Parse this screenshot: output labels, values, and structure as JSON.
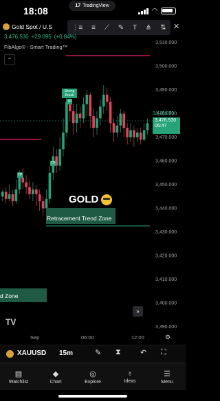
{
  "status": {
    "time": "18:08",
    "app_pill": "TradingView"
  },
  "header": {
    "symbol_title": "Gold Spot / U.S",
    "price": "3,476.530",
    "change": "+29.095",
    "change_pct": "(+0.84%)",
    "indicator": "FibAlgo® - Smart Trading™",
    "collapse_icon": "chevron-up-icon"
  },
  "chart": {
    "price_tag_top": "3,478.070",
    "price_tag_value": "3,476.530",
    "price_tag_countdown": "06:47",
    "signals": [
      "Strong Break",
      "TP",
      "TP",
      "TP"
    ],
    "zone_label": "Retracement Trend Zone",
    "zone_label_lower": "d Zone",
    "caption": "GOLD",
    "y_axis": [
      "3,510.000",
      "3,500.000",
      "3,490.000",
      "3,480.000",
      "3,470.000",
      "3,460.000",
      "3,450.000",
      "3,440.000",
      "3,430.000",
      "3,420.000",
      "3,410.000",
      "3,400.000",
      "3,390.000"
    ],
    "x_axis": [
      "Sep",
      "06:00",
      "12:00"
    ],
    "logo": "TV",
    "colors": {
      "up": "#27a37a",
      "down": "#e0445a",
      "zone": "#1f5a45",
      "resistance": "#c2185b"
    }
  },
  "symbol_bar": {
    "symbol": "XAUUSD",
    "interval": "15m"
  },
  "tabs": [
    {
      "label": "Watchlist",
      "icon": "watchlist-icon"
    },
    {
      "label": "Chart",
      "icon": "chart-icon"
    },
    {
      "label": "Explore",
      "icon": "explore-icon"
    },
    {
      "label": "Ideas",
      "icon": "ideas-icon"
    },
    {
      "label": "Menu",
      "icon": "menu-icon"
    }
  ]
}
